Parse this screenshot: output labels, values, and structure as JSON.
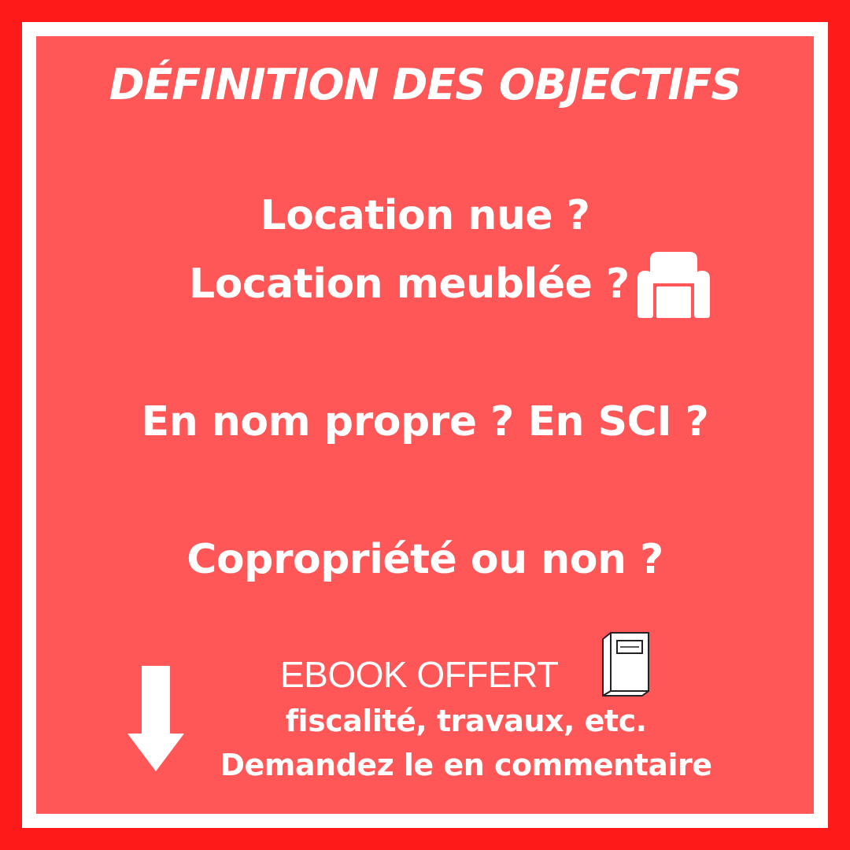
{
  "title": "DÉFINITION DES OBJECTIFS",
  "questions": {
    "q1": "Location nue ?",
    "q2": "Location meublée ?",
    "q3": "En nom propre ? En SCI ?",
    "q4": "Copropriété ou non ?"
  },
  "footer": {
    "ebook": "EBOOK OFFERT",
    "subtitle": "fiscalité, travaux, etc.",
    "cta": "Demandez le en commentaire"
  },
  "icons": {
    "armchair": "armchair-icon",
    "book": "book-icon",
    "arrow": "arrow-down-icon"
  },
  "colors": {
    "outer": "#ff1a1a",
    "panel": "#ff5757",
    "border": "#ffffff",
    "text": "#ffffff"
  }
}
